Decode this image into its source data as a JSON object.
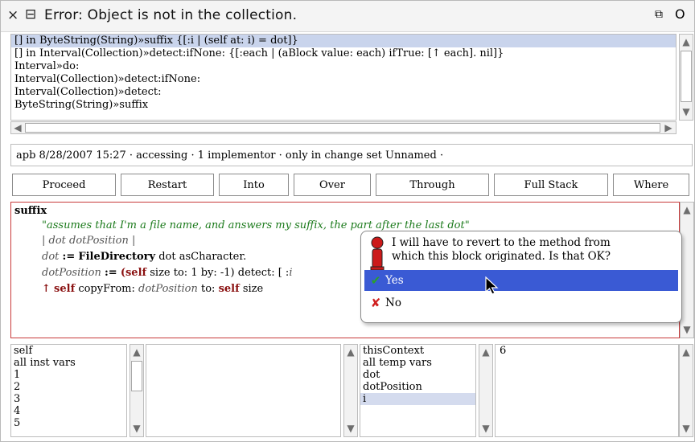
{
  "window": {
    "title": "Error: Object is not in the collection.",
    "close_glyph": "×",
    "menu_glyph": "⊟",
    "collapse_glyph": "⧉",
    "expand_glyph": "O"
  },
  "stack_list": {
    "items": [
      "[] in ByteString(String)»suffix {[:i | (self at: i)  = dot]}",
      "[] in Interval(Collection)»detect:ifNone: {[:each |  (aBlock value: each)   ifTrue: [↑ each].  nil]}",
      "Interval»do:",
      "Interval(Collection)»detect:ifNone:",
      "Interval(Collection)»detect:",
      "ByteString(String)»suffix"
    ],
    "selected_index": 0
  },
  "info_bar": {
    "text": "apb 8/28/2007 15:27 · accessing · 1 implementor · only in change set Unnamed  ·"
  },
  "buttons": [
    "Proceed",
    "Restart",
    "Into",
    "Over",
    "Through",
    "Full Stack",
    "Where"
  ],
  "code": {
    "selector": "suffix",
    "comment": "\"assumes that I'm a file name, and answers my suffix, the part after the last dot\"",
    "temps": "| dot dotPosition |",
    "line3_var": "dot",
    "line3_assign": ":=",
    "line3_class": "FileDirectory",
    "line3_rest": "dot asCharacter.",
    "line4_var": "dotPosition",
    "line4_assign": ":=",
    "line4_paren": "(",
    "line4_self": "self",
    "line4_rest_a": "size to: 1 by: -1) detect: [ :",
    "line4_i": "i",
    "line5_caret": "↑",
    "line5_self": "self",
    "line5_rest_a": "copyFrom:",
    "line5_var": "dotPosition",
    "line5_rest_b": "to:",
    "line5_self2": "self",
    "line5_rest_c": "size"
  },
  "dialog": {
    "message_line1": "I will have to revert to the method from",
    "message_line2": "which this block originated.  Is that OK?",
    "options": [
      {
        "label": "Yes",
        "glyph": "✔",
        "selected": true
      },
      {
        "label": "No",
        "glyph": "✘",
        "selected": false
      }
    ],
    "colors": {
      "selection": "#3a5ad4",
      "check": "#2aa02a",
      "cross": "#d02020",
      "icon": "#cc1a1a"
    }
  },
  "receiver_fields": {
    "items": [
      "self",
      "all inst vars",
      "1",
      "2",
      "3",
      "4",
      "5"
    ]
  },
  "receiver_value": {
    "text": ""
  },
  "context_fields": {
    "items": [
      "thisContext",
      "all temp vars",
      "dot",
      "dotPosition",
      "i"
    ],
    "selected_index": 4
  },
  "context_value": {
    "text": "6"
  }
}
